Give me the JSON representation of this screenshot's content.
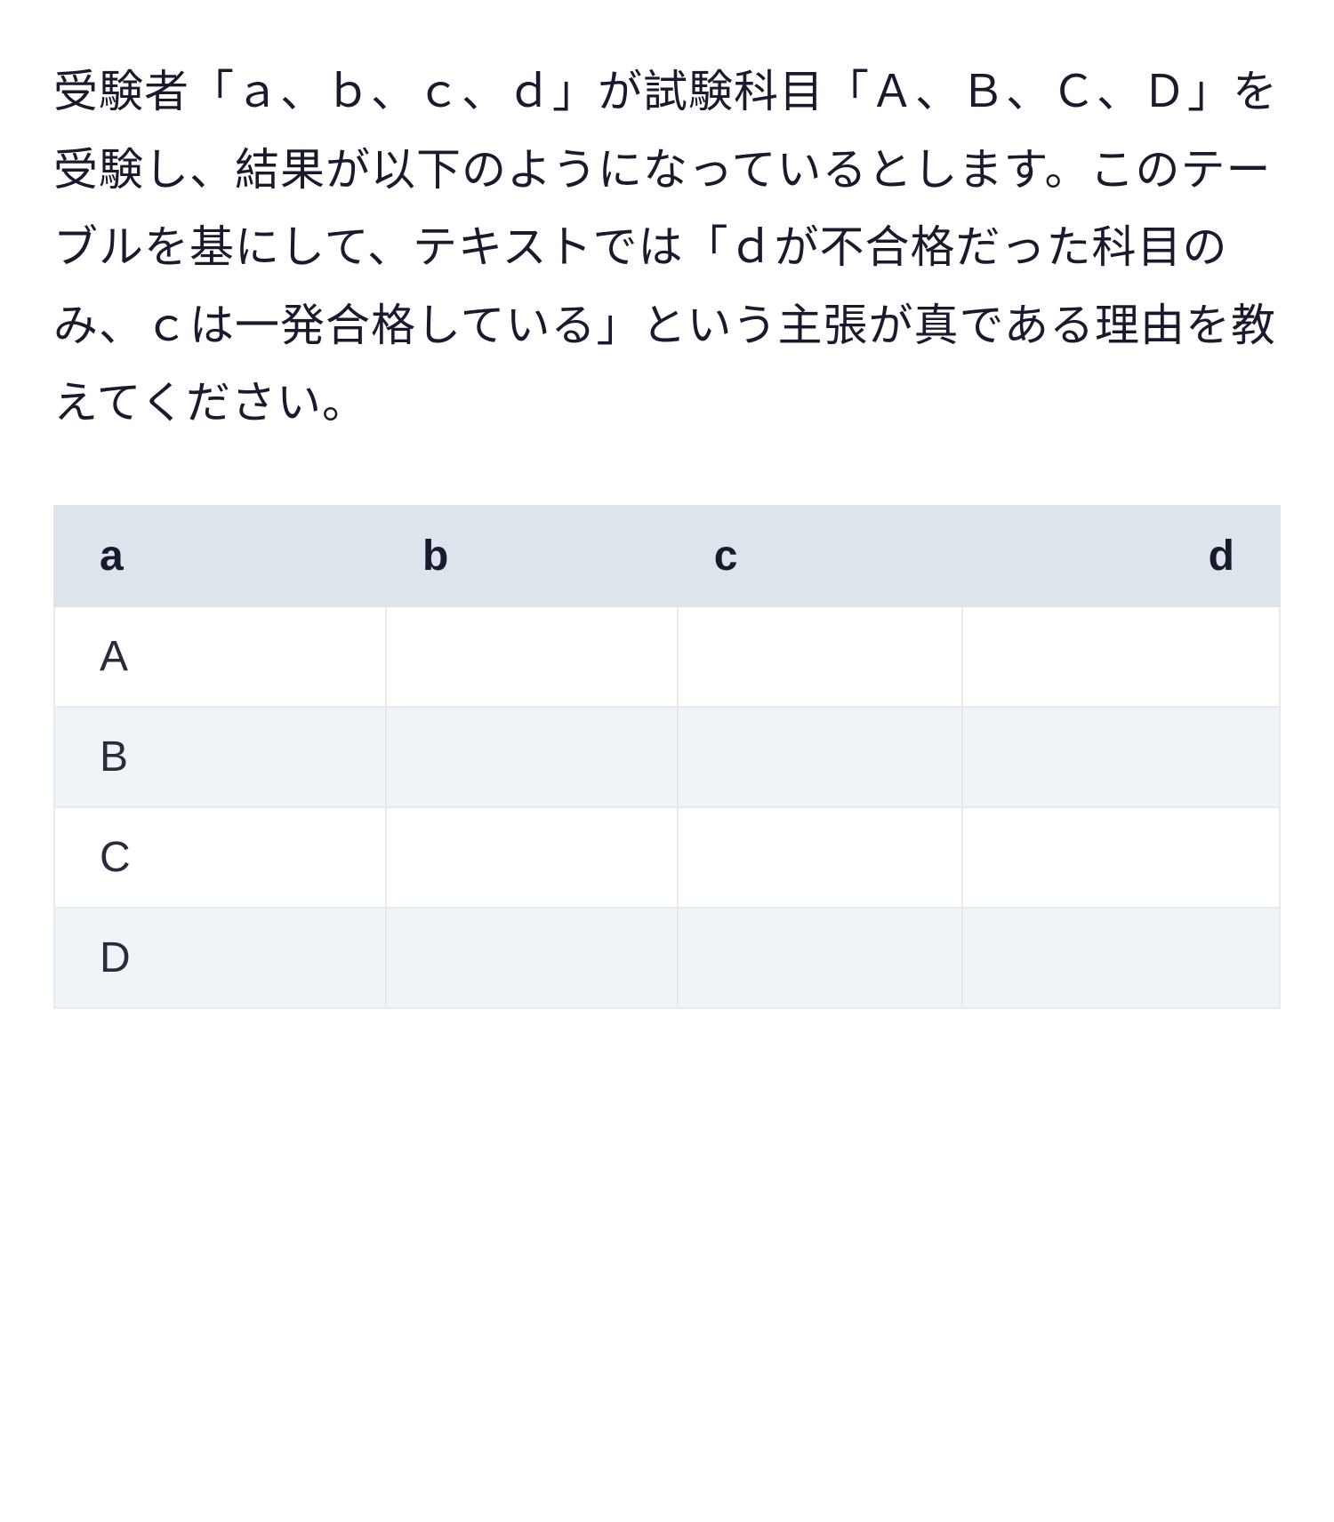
{
  "paragraph": "受験者「ａ、ｂ、ｃ、ｄ」が試験科目「Ａ、Ｂ、Ｃ、Ｄ」を受験し、結果が以下のようになっているとします。このテーブルを基にして、テキストでは「ｄが不合格だった科目のみ、ｃは一発合格している」という主張が真である理由を教えてください。",
  "chart_data": {
    "type": "table",
    "headers": [
      "a",
      "b",
      "c",
      "d"
    ],
    "rows": [
      {
        "label": "A",
        "cells": [
          "",
          "",
          ""
        ]
      },
      {
        "label": "B",
        "cells": [
          "",
          "",
          ""
        ]
      },
      {
        "label": "C",
        "cells": [
          "",
          "",
          ""
        ]
      },
      {
        "label": "D",
        "cells": [
          "",
          "",
          ""
        ]
      }
    ]
  }
}
